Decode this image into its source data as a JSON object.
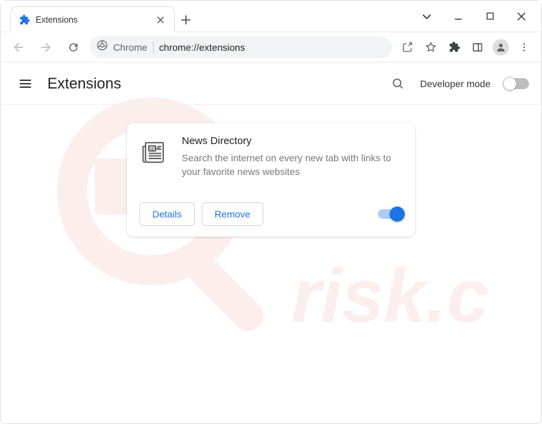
{
  "window": {
    "tab_title": "Extensions",
    "window_controls": {
      "caret": "chevron-down",
      "minimize": "minimize",
      "maximize": "maximize",
      "close": "close"
    }
  },
  "toolbar": {
    "back_enabled": false,
    "forward_enabled": false,
    "omnibox": {
      "host_label": "Chrome",
      "url_text": "chrome://extensions"
    }
  },
  "header": {
    "title": "Extensions",
    "devmode_label": "Developer mode",
    "devmode_on": false
  },
  "extension": {
    "name": "News Directory",
    "description": "Search the internet on every new tab with links to your favorite news websites",
    "enabled": true,
    "buttons": {
      "details": "Details",
      "remove": "Remove"
    },
    "icon": "news-icon"
  }
}
